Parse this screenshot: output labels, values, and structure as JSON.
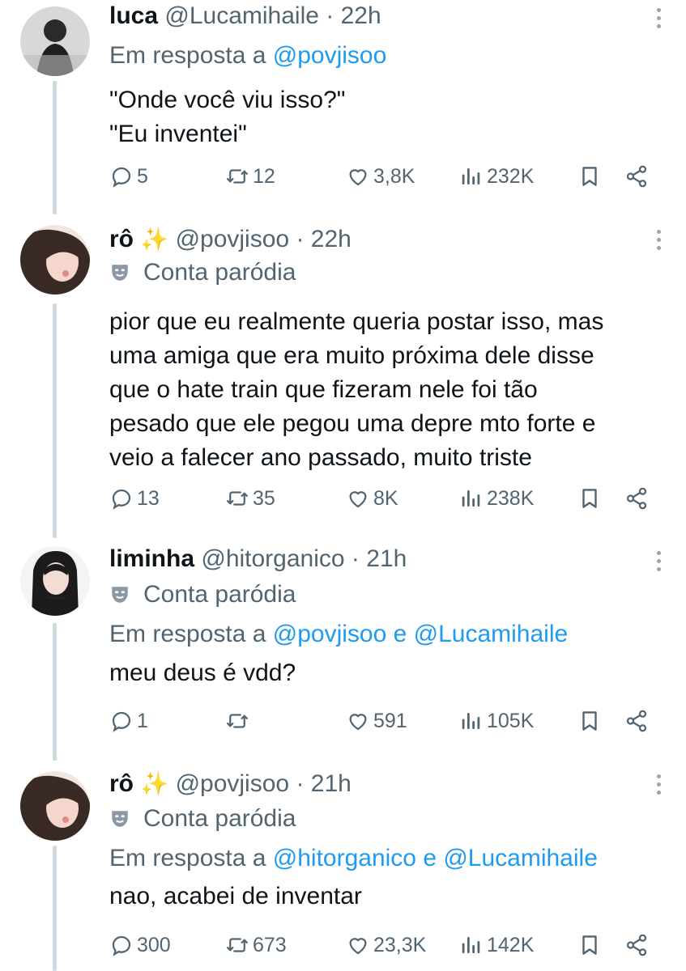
{
  "tweets": [
    {
      "name": "luca",
      "handle": "@Lucamihaile",
      "separator": "·",
      "time": "22h",
      "reply_prefix": "Em resposta a",
      "reply_to": "@povjisoo",
      "text": "\"Onde você viu isso?\"\n\"Eu inventei\"",
      "stats": {
        "replies": "5",
        "reposts": "12",
        "likes": "3,8K",
        "views": "232K"
      }
    },
    {
      "name": "rô",
      "emoji": "✨",
      "handle": "@povjisoo",
      "separator": "·",
      "time": "22h",
      "badge": "Conta paródia",
      "text": "pior que eu realmente queria postar isso, mas\numa amiga que era muito próxima dele disse\nque o hate train que fizeram nele foi tão\npesado que ele pegou uma depre mto forte e\nveio a falecer ano passado, muito triste",
      "stats": {
        "replies": "13",
        "reposts": "35",
        "likes": "8K",
        "views": "238K"
      }
    },
    {
      "name": "liminha",
      "handle": "@hitorganico",
      "separator": "·",
      "time": "21h",
      "badge": "Conta paródia",
      "reply_prefix": "Em resposta a",
      "reply_to": "@povjisoo e @Lucamihaile",
      "text": "meu deus é vdd?",
      "stats": {
        "replies": "1",
        "reposts": "",
        "likes": "591",
        "views": "105K"
      }
    },
    {
      "name": "rô",
      "emoji": "✨",
      "handle": "@povjisoo",
      "separator": "·",
      "time": "21h",
      "badge": "Conta paródia",
      "reply_prefix": "Em resposta a",
      "reply_to": "@hitorganico e @Lucamihaile",
      "text": "nao, acabei de inventar",
      "stats": {
        "replies": "300",
        "reposts": "673",
        "likes": "23,3K",
        "views": "142K"
      }
    }
  ],
  "icons": {
    "reply": "reply-icon",
    "repost": "repost-icon",
    "like": "heart-icon",
    "views": "views-icon",
    "bookmark": "bookmark-icon",
    "share": "share-icon",
    "more": "more-icon",
    "parody": "parody-mask-icon"
  },
  "colors": {
    "link": "#1d9bf0",
    "secondary": "#536471",
    "text": "#0f1419",
    "thread": "#cfd9de"
  }
}
